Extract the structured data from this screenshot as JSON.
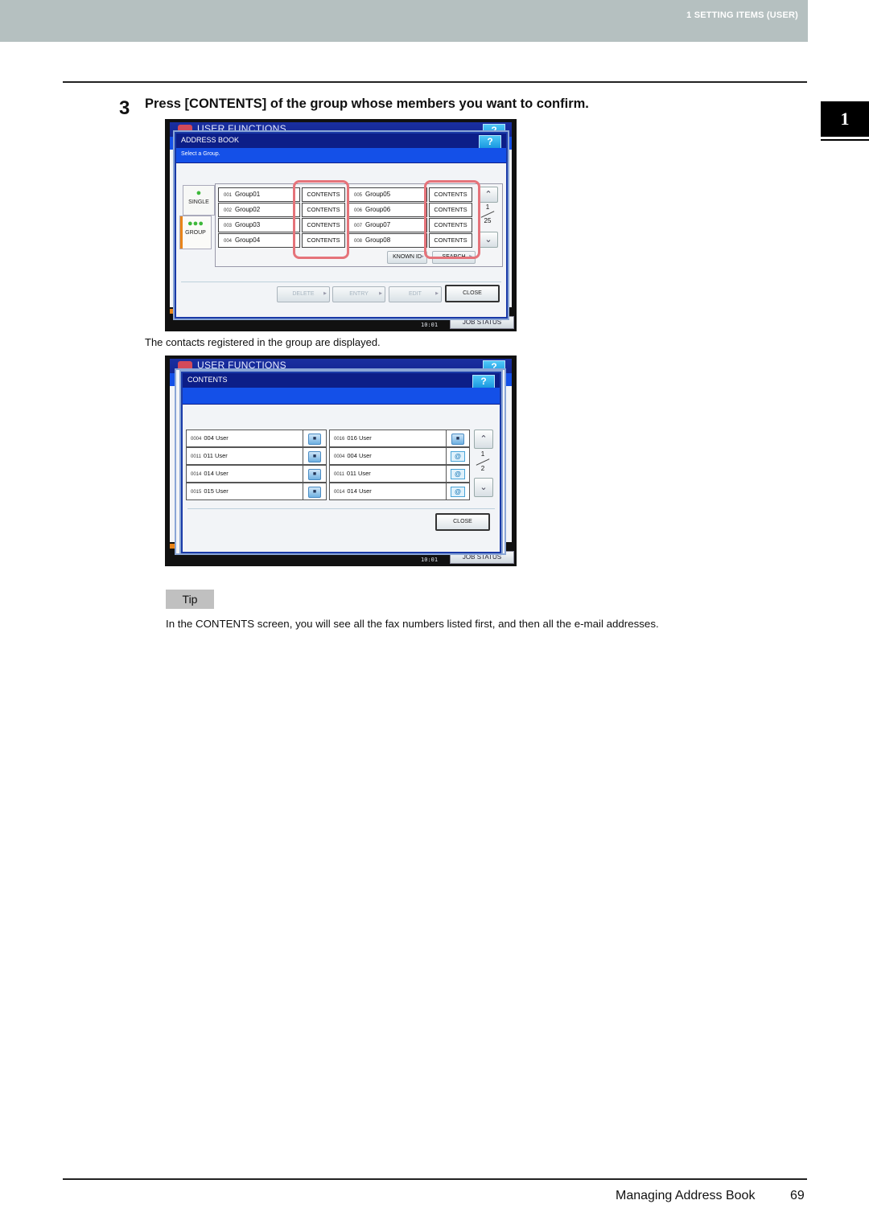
{
  "header": {
    "section_label": "1 SETTING ITEMS (USER)"
  },
  "chapter_tab": "1",
  "step": {
    "number": "3",
    "title": "Press [CONTENTS] of the group whose members you want to confirm."
  },
  "screen1": {
    "app_title": "USER FUNCTIONS",
    "help": "?",
    "dialog_title": "ADDRESS BOOK",
    "instruction": "Select a Group.",
    "side_tabs": [
      {
        "label": "SINGLE",
        "icon": "person-icon"
      },
      {
        "label": "GROUP",
        "icon": "group-icon",
        "selected": true
      }
    ],
    "groups_left": [
      {
        "num": "001",
        "name": "Group01",
        "button": "CONTENTS"
      },
      {
        "num": "002",
        "name": "Group02",
        "button": "CONTENTS"
      },
      {
        "num": "003",
        "name": "Group03",
        "button": "CONTENTS"
      },
      {
        "num": "004",
        "name": "Group04",
        "button": "CONTENTS"
      }
    ],
    "groups_right": [
      {
        "num": "005",
        "name": "Group05",
        "button": "CONTENTS"
      },
      {
        "num": "006",
        "name": "Group06",
        "button": "CONTENTS"
      },
      {
        "num": "007",
        "name": "Group07",
        "button": "CONTENTS"
      },
      {
        "num": "008",
        "name": "Group08",
        "button": "CONTENTS"
      }
    ],
    "page_current": "1",
    "page_total": "25",
    "known_id": "KNOWN ID",
    "search": "SEARCH",
    "buttons": {
      "delete": "DELETE",
      "entry": "ENTRY",
      "edit": "EDIT",
      "close": "CLOSE"
    },
    "clock": "10:01",
    "job_status": "JOB STATUS",
    "highlight_color": "#e5737a"
  },
  "caption": "The contacts registered in the group are displayed.",
  "screen2": {
    "app_title": "USER FUNCTIONS",
    "help": "?",
    "dialog_title": "CONTENTS",
    "members_left": [
      {
        "num": "0004",
        "name": "004 User",
        "type": "fax"
      },
      {
        "num": "0011",
        "name": "011 User",
        "type": "fax"
      },
      {
        "num": "0014",
        "name": "014 User",
        "type": "fax"
      },
      {
        "num": "0015",
        "name": "015 User",
        "type": "fax"
      }
    ],
    "members_right": [
      {
        "num": "0016",
        "name": "016 User",
        "type": "fax"
      },
      {
        "num": "0004",
        "name": "004 User",
        "type": "email"
      },
      {
        "num": "0011",
        "name": "011 User",
        "type": "email"
      },
      {
        "num": "0014",
        "name": "014 User",
        "type": "email"
      }
    ],
    "page_current": "1",
    "page_total": "2",
    "close": "CLOSE",
    "clock": "10:01",
    "job_status": "JOB STATUS"
  },
  "tip": {
    "label": "Tip",
    "text": "In the CONTENTS screen, you will see all the fax numbers listed first, and then all the e-mail addresses."
  },
  "footer": {
    "title": "Managing Address Book",
    "page": "69"
  }
}
